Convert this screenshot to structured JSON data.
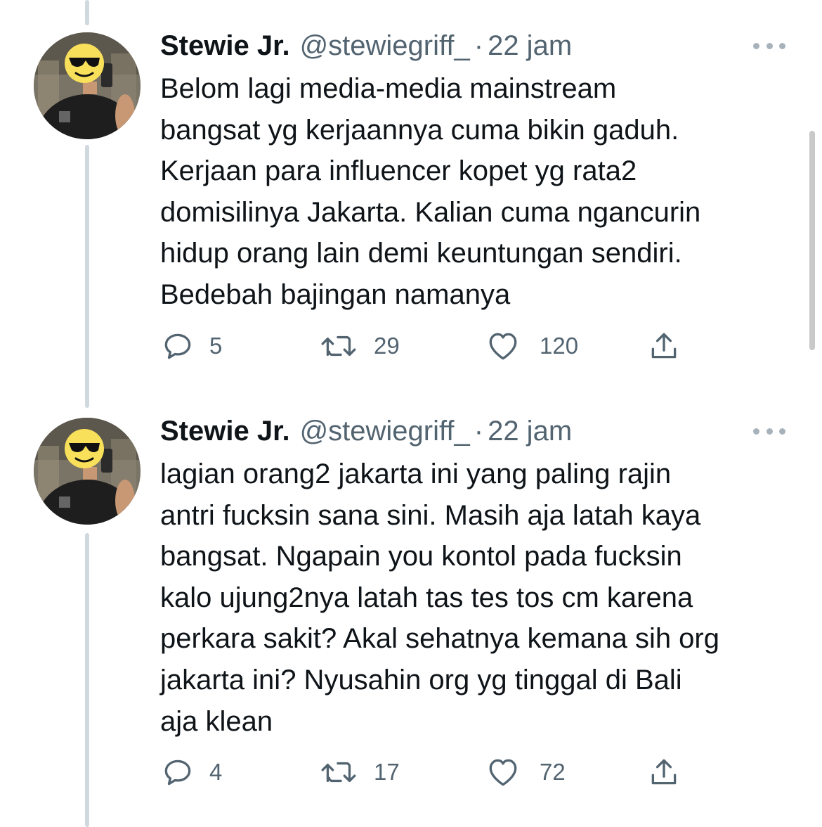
{
  "tweets": [
    {
      "author_name": "Stewie Jr.",
      "handle": "@stewiegriff_",
      "separator": "·",
      "time": "22 jam",
      "text_lines": [
        "Belom lagi media-media mainstream",
        "bangsat yg kerjaannya cuma bikin gaduh.",
        "Kerjaan para influencer kopet yg rata2",
        "domisilinya Jakarta. Kalian cuma ngancurin",
        "hidup orang lain demi keuntungan sendiri.",
        "Bedebah bajingan namanya"
      ],
      "replies": "5",
      "retweets": "29",
      "likes": "120"
    },
    {
      "author_name": "Stewie Jr.",
      "handle": "@stewiegriff_",
      "separator": "·",
      "time": "22 jam",
      "text_lines": [
        "lagian orang2 jakarta ini yang paling rajin",
        "antri fucksin sana sini. Masih aja latah kaya",
        "bangsat. Ngapain you kontol pada fucksin",
        "kalo ujung2nya latah tas tes tos cm karena",
        "perkara sakit? Akal sehatnya kemana sih org",
        "jakarta ini? Nyusahin org yg tinggal di Bali",
        "aja klean"
      ],
      "replies": "4",
      "retweets": "17",
      "likes": "72"
    }
  ],
  "icons": {
    "reply": "reply-icon",
    "retweet": "retweet-icon",
    "like": "heart-icon",
    "share": "share-icon",
    "more": "more-options-icon"
  },
  "colors": {
    "text": "#0f1419",
    "secondary": "#536471",
    "thread_line": "#cfd9de"
  }
}
